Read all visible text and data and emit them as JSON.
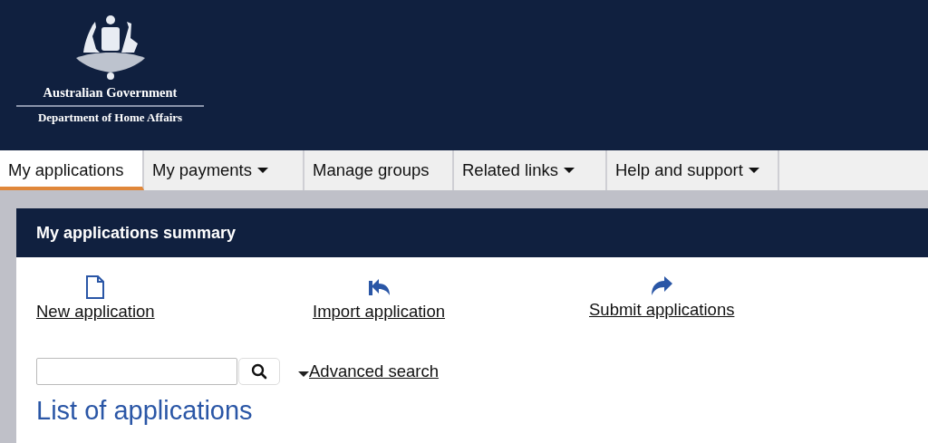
{
  "header": {
    "logo_line_1": "Australian Government",
    "logo_line_2": "Department of Home Affairs"
  },
  "nav": [
    {
      "label": "My applications",
      "selected": true,
      "dropdown": false
    },
    {
      "label": "My payments",
      "selected": false,
      "dropdown": true
    },
    {
      "label": "Manage groups",
      "selected": false,
      "dropdown": false
    },
    {
      "label": "Related links",
      "selected": false,
      "dropdown": true
    },
    {
      "label": "Help and support",
      "selected": false,
      "dropdown": true
    }
  ],
  "panel": {
    "title": "My applications summary",
    "actions": [
      {
        "kind": "new",
        "label": "New application"
      },
      {
        "kind": "import",
        "label": "Import application"
      },
      {
        "kind": "submit",
        "label": "Submit applications"
      }
    ],
    "search": {
      "advanced_link": "Advanced search"
    },
    "list_heading": "List of applications"
  }
}
